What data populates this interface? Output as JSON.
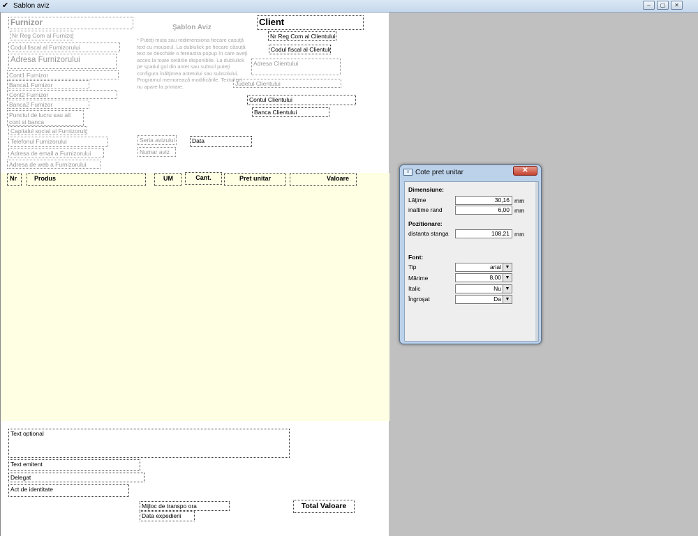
{
  "window": {
    "title": "Sablon aviz",
    "minimize": "–",
    "restore": "▢",
    "close": "✕"
  },
  "furnizor": {
    "name": "Furnizor",
    "reg_com": "Nr Reg Com al Furnizor",
    "cod_fiscal": "Codul fiscal al Furnizorului",
    "adresa": "Adresa Furnizorului",
    "cont1": "Cont1 Furnizor",
    "banca1": "Banca1 Furnizor",
    "cont2": "Cont2 Furnizor",
    "banca2": "Banca2 Furnizor",
    "punct_lucru": "Punctul de lucru sau alt\ncont si banca",
    "capital": "Capitalul social al Furnizorului",
    "telefon": "Telefonul Furnizorului",
    "email": "Adresa de email a Furnizorului",
    "web": "Adresa de web a Furnizorului"
  },
  "template": {
    "title": "Şablon Aviz",
    "note": "* Puteţi muta sau redimensiona fiecare casuţă\ntext cu mouseul. La dublulick pe fiecare căsuţă\ntext se deschide o fereastra popup în care aveţi\nacces la toate setările disponibile. La dublulick\npe spatiul gol din antet sau subsol puteţi\nconfigura înălţimea antetului sau subsolului.\nProgramul memorează modificările. Textul gri\nnu apare la printare."
  },
  "client": {
    "name": "Client",
    "reg_com": "Nr Reg Com al Clientului",
    "cod_fiscal": "Codul fiscal al Clientului",
    "adresa": "Adresa Clientului",
    "judet": "Judetul Clientului",
    "cont": "Contul Clientului",
    "banca": "Banca Clientului"
  },
  "aviz": {
    "seria": "Seria avizului",
    "numar": "Numar aviz",
    "data": "Data"
  },
  "table_headers": {
    "nr": "Nr",
    "produs": "Produs",
    "um": "UM",
    "cant": "Cant.",
    "pret": "Pret unitar",
    "valoare": "Valoare"
  },
  "footer": {
    "text_optional": "Text optional",
    "text_emitent": "Text emitent",
    "delegat": "Delegat",
    "act": "Act de identitate",
    "mijloc": "Mijloc de transpo ora",
    "data_exp": "Data expedierii",
    "total": "Total Valoare"
  },
  "dialog": {
    "title": "Cote pret unitar",
    "sections": {
      "dimensiune": "Dimensiune:",
      "pozitionare": "Pozitionare:",
      "font": "Font:"
    },
    "latime": {
      "label": "Lăţime",
      "value": "30,16",
      "unit": "mm"
    },
    "inaltime": {
      "label": "inaltime rand",
      "value": "6,00",
      "unit": "mm"
    },
    "distanta": {
      "label": "distanta stanga",
      "value": "108,21",
      "unit": "mm"
    },
    "tip": {
      "label": "Tip",
      "value": "arial"
    },
    "marime": {
      "label": "Mărime",
      "value": "8,00"
    },
    "italic": {
      "label": "Italic",
      "value": "Nu"
    },
    "ingrosat": {
      "label": "Îngroşat",
      "value": "Da"
    }
  }
}
